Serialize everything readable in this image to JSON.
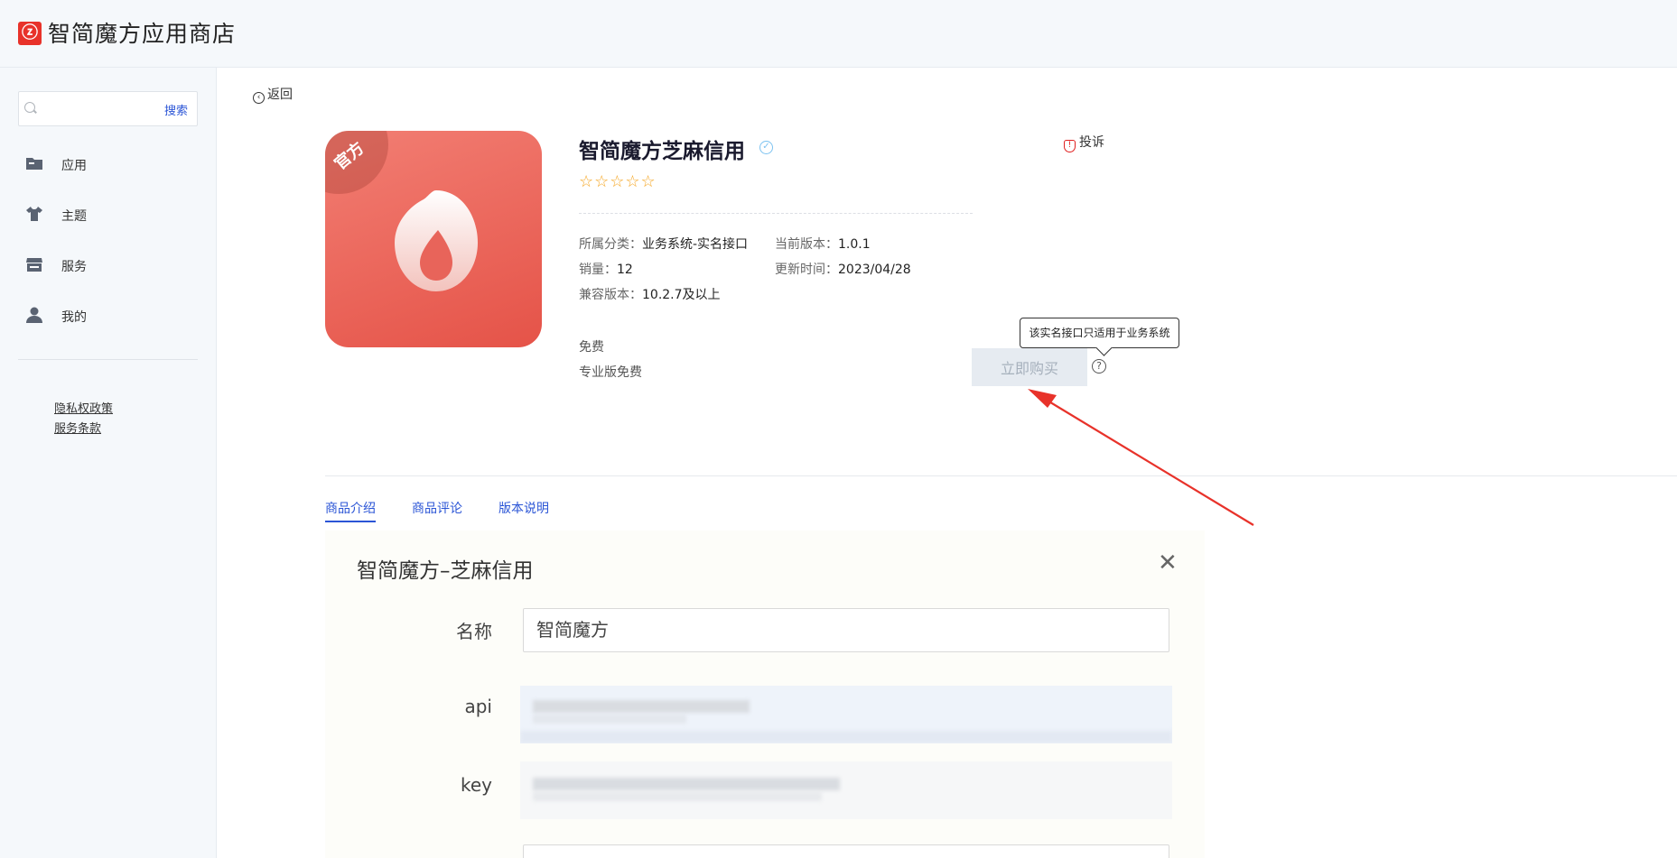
{
  "header": {
    "app_title": "智简魔方应用商店"
  },
  "sidebar": {
    "search_button": "搜索",
    "items": [
      {
        "label": "应用"
      },
      {
        "label": "主题"
      },
      {
        "label": "服务"
      },
      {
        "label": "我的"
      }
    ],
    "links": [
      "隐私权政策",
      "服务条款"
    ]
  },
  "back": {
    "label": "返回"
  },
  "product": {
    "icon_badge": "官方",
    "title": "智简魔方芝麻信用",
    "rating_stars": "☆☆☆☆☆",
    "category_label": "所属分类：",
    "category_value": "业务系统-实名接口",
    "version_label": "当前版本：",
    "version_value": "1.0.1",
    "sales_label": "销量：",
    "sales_value": "12",
    "updated_label": "更新时间：",
    "updated_value": "2023/04/28",
    "compat_label": "兼容版本：",
    "compat_value": "10.2.7及以上",
    "price_free": "免费",
    "price_pro": "专业版免费",
    "report_label": "投诉",
    "buy_button": "立即购买",
    "tooltip": "该实名接口只适用于业务系统"
  },
  "tabs": [
    {
      "label": "商品介绍",
      "active": true
    },
    {
      "label": "商品评论",
      "active": false
    },
    {
      "label": "版本说明",
      "active": false
    }
  ],
  "screenshot_dialog": {
    "title": "智简魔方–芝麻信用",
    "close": "✕",
    "fields": [
      {
        "label": "名称",
        "value": "智简魔方"
      },
      {
        "label": "api",
        "value": ""
      },
      {
        "label": "key",
        "value": ""
      }
    ]
  },
  "colors": {
    "accent": "#2b55d6",
    "brand_red": "#e8322a",
    "arrow": "#e8322a"
  }
}
